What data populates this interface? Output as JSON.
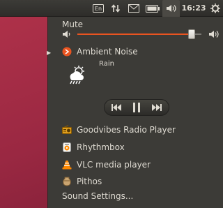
{
  "topbar": {
    "clock": "16:23",
    "icons": [
      "keyboard-icon",
      "network-icon",
      "mail-icon",
      "battery-icon",
      "volume-icon"
    ]
  },
  "menu": {
    "mute_label": "Mute",
    "volume_level": 0.92,
    "player": {
      "name": "Ambient Noise",
      "track": "Rain",
      "controls": [
        "previous",
        "pause",
        "next"
      ]
    },
    "players": [
      {
        "name": "Goodvibes Radio Player",
        "icon": "radio-icon"
      },
      {
        "name": "Rhythmbox",
        "icon": "rhythmbox-icon"
      },
      {
        "name": "VLC media player",
        "icon": "vlc-icon"
      },
      {
        "name": "Pithos",
        "icon": "pithos-icon"
      }
    ],
    "settings_label": "Sound Settings..."
  },
  "colors": {
    "accent": "#e95420",
    "panel": "#3c3b37",
    "desktop": "#9a2842"
  }
}
